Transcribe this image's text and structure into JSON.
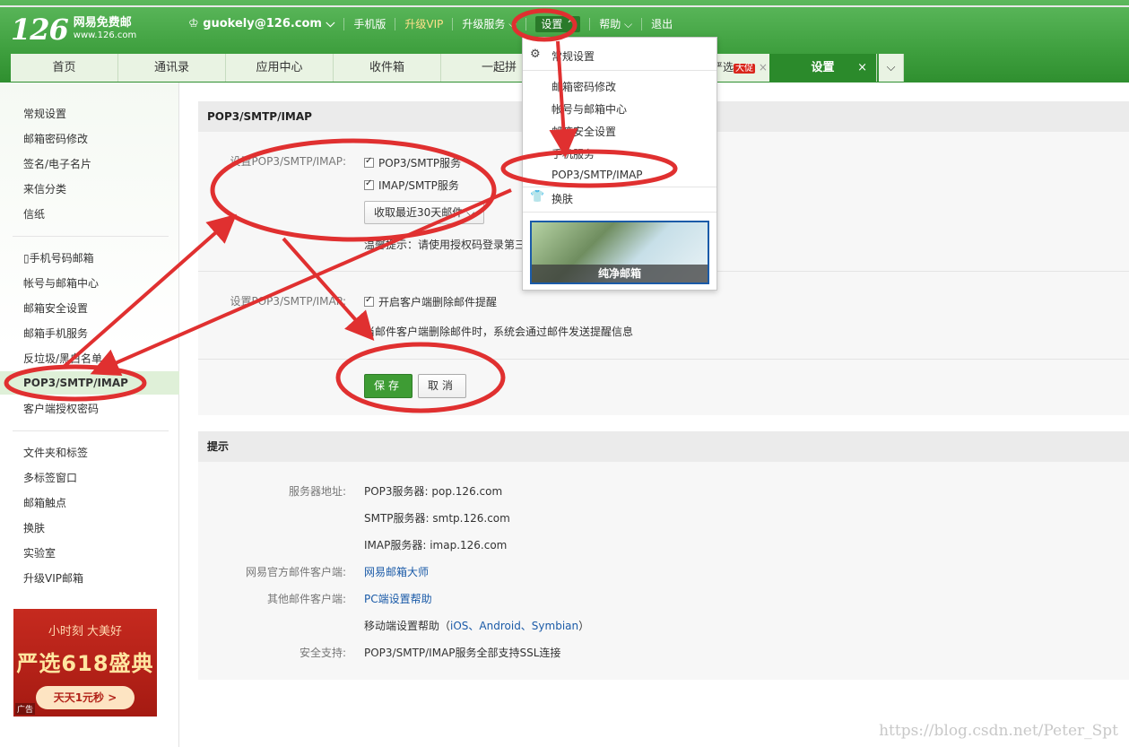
{
  "header": {
    "logo_num": "126",
    "logo_line1": "网易免费邮",
    "logo_line2": "www.126.com",
    "user": "guokely@126.com",
    "nav": [
      "手机版",
      "升级VIP",
      "升级服务",
      "设置",
      "帮助",
      "退出"
    ]
  },
  "tabs": [
    "首页",
    "通讯录",
    "应用中心",
    "收件箱",
    "一起拼"
  ],
  "tab_hidden": {
    "label_fragment": "严选",
    "badge": "大促"
  },
  "active_tab": {
    "label": "设置",
    "close": "×"
  },
  "sidebar": {
    "group1": [
      "常规设置",
      "邮箱密码修改",
      "签名/电子名片",
      "来信分类",
      "信纸"
    ],
    "group2": [
      "手机号码邮箱",
      "帐号与邮箱中心",
      "邮箱安全设置",
      "邮箱手机服务",
      "反垃圾/黑白名单"
    ],
    "active": "POP3/SMTP/IMAP",
    "group2b": [
      "客户端授权密码"
    ],
    "group3": [
      "文件夹和标签",
      "多标签窗口",
      "邮箱触点",
      "换肤",
      "实验室",
      "升级VIP邮箱"
    ]
  },
  "ad": {
    "line1": "小时刻 大美好",
    "line2": "严选618盛典",
    "cta": "天天1元秒 >",
    "tag": "广告"
  },
  "section1": {
    "title": "POP3/SMTP/IMAP",
    "label1": "设置POP3/SMTP/IMAP:",
    "opt_pop3": "POP3/SMTP服务",
    "opt_imap": "IMAP/SMTP服务",
    "select_value": "收取最近30天邮件",
    "tip": "温馨提示：请使用授权码登录第三",
    "label2": "设置POP3/SMTP/IMAP:",
    "opt_delete_notice": "开启客户端删除邮件提醒",
    "delete_desc": "当邮件客户端删除邮件时，系统会通过邮件发送提醒信息",
    "save": "保存",
    "cancel": "取消"
  },
  "section2": {
    "title": "提示",
    "server_label": "服务器地址:",
    "pop3": "POP3服务器: pop.126.com",
    "smtp": "SMTP服务器: smtp.126.com",
    "imap": "IMAP服务器: imap.126.com",
    "official_label": "网易官方邮件客户端:",
    "official_link": "网易邮箱大师",
    "other_label": "其他邮件客户端:",
    "pc_link": "PC端设置帮助",
    "mobile_prefix": "移动端设置帮助（",
    "mobile_links": "iOS、Android、Symbian",
    "mobile_suffix": "）",
    "ssl_label": "安全支持:",
    "ssl_value": "POP3/SMTP/IMAP服务全部支持SSL连接"
  },
  "dropdown": {
    "general": "常规设置",
    "items": [
      "邮箱密码修改",
      "帐号与邮箱中心",
      "邮箱安全设置",
      "手机服务",
      "POP3/SMTP/IMAP"
    ],
    "skin": "换肤",
    "skin_caption": "纯净邮箱"
  },
  "watermark": "https://blog.csdn.net/Peter_Spt",
  "colors": {
    "header_green": "#3fa03f",
    "active_tab": "#2b8a2b",
    "annotation_red": "#e03030",
    "link": "#1b5ba8"
  }
}
